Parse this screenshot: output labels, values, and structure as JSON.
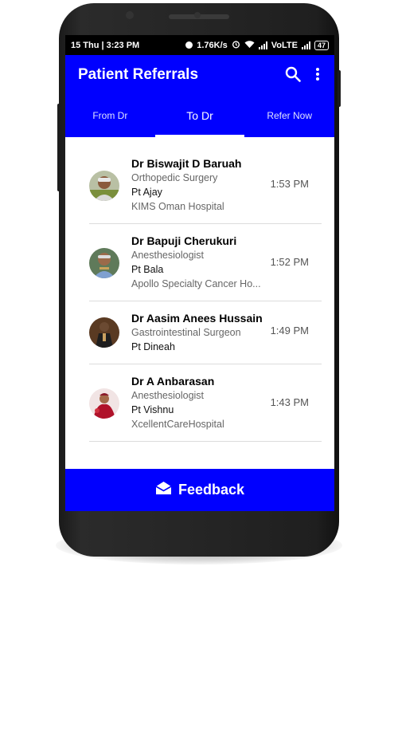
{
  "status_bar": {
    "left": "15 Thu | 3:23 PM",
    "speed": "1.76K/s",
    "network": "VoLTE",
    "battery": "47"
  },
  "app_bar": {
    "title": "Patient Referrals",
    "icons": [
      "search-icon",
      "more-vert-icon"
    ]
  },
  "tabs": [
    {
      "label": "From Dr",
      "active": false
    },
    {
      "label": "To Dr",
      "active": true
    },
    {
      "label": "Refer Now",
      "active": false
    }
  ],
  "referrals": [
    {
      "name": "Dr Biswajit D Baruah",
      "specialty": "Orthopedic Surgery",
      "patient": "Pt Ajay",
      "hospital": "KIMS Oman Hospital",
      "time": "1:53 PM"
    },
    {
      "name": "Dr Bapuji Cherukuri",
      "specialty": "Anesthesiologist",
      "patient": "Pt Bala",
      "hospital": "Apollo Specialty Cancer Ho...",
      "time": "1:52 PM"
    },
    {
      "name": "Dr Aasim Anees Hussain",
      "specialty": "Gastrointestinal Surgeon",
      "patient": "Pt Dineah",
      "hospital": "",
      "time": "1:49 PM"
    },
    {
      "name": "Dr A Anbarasan",
      "specialty": "Anesthesiologist",
      "patient": "Pt Vishnu",
      "hospital": "XcellentCareHospital",
      "time": "1:43 PM"
    }
  ],
  "feedback": {
    "label": "Feedback",
    "icon": "envelope-open-icon"
  },
  "colors": {
    "primary": "#0000ff",
    "status_bar": "#000000"
  }
}
